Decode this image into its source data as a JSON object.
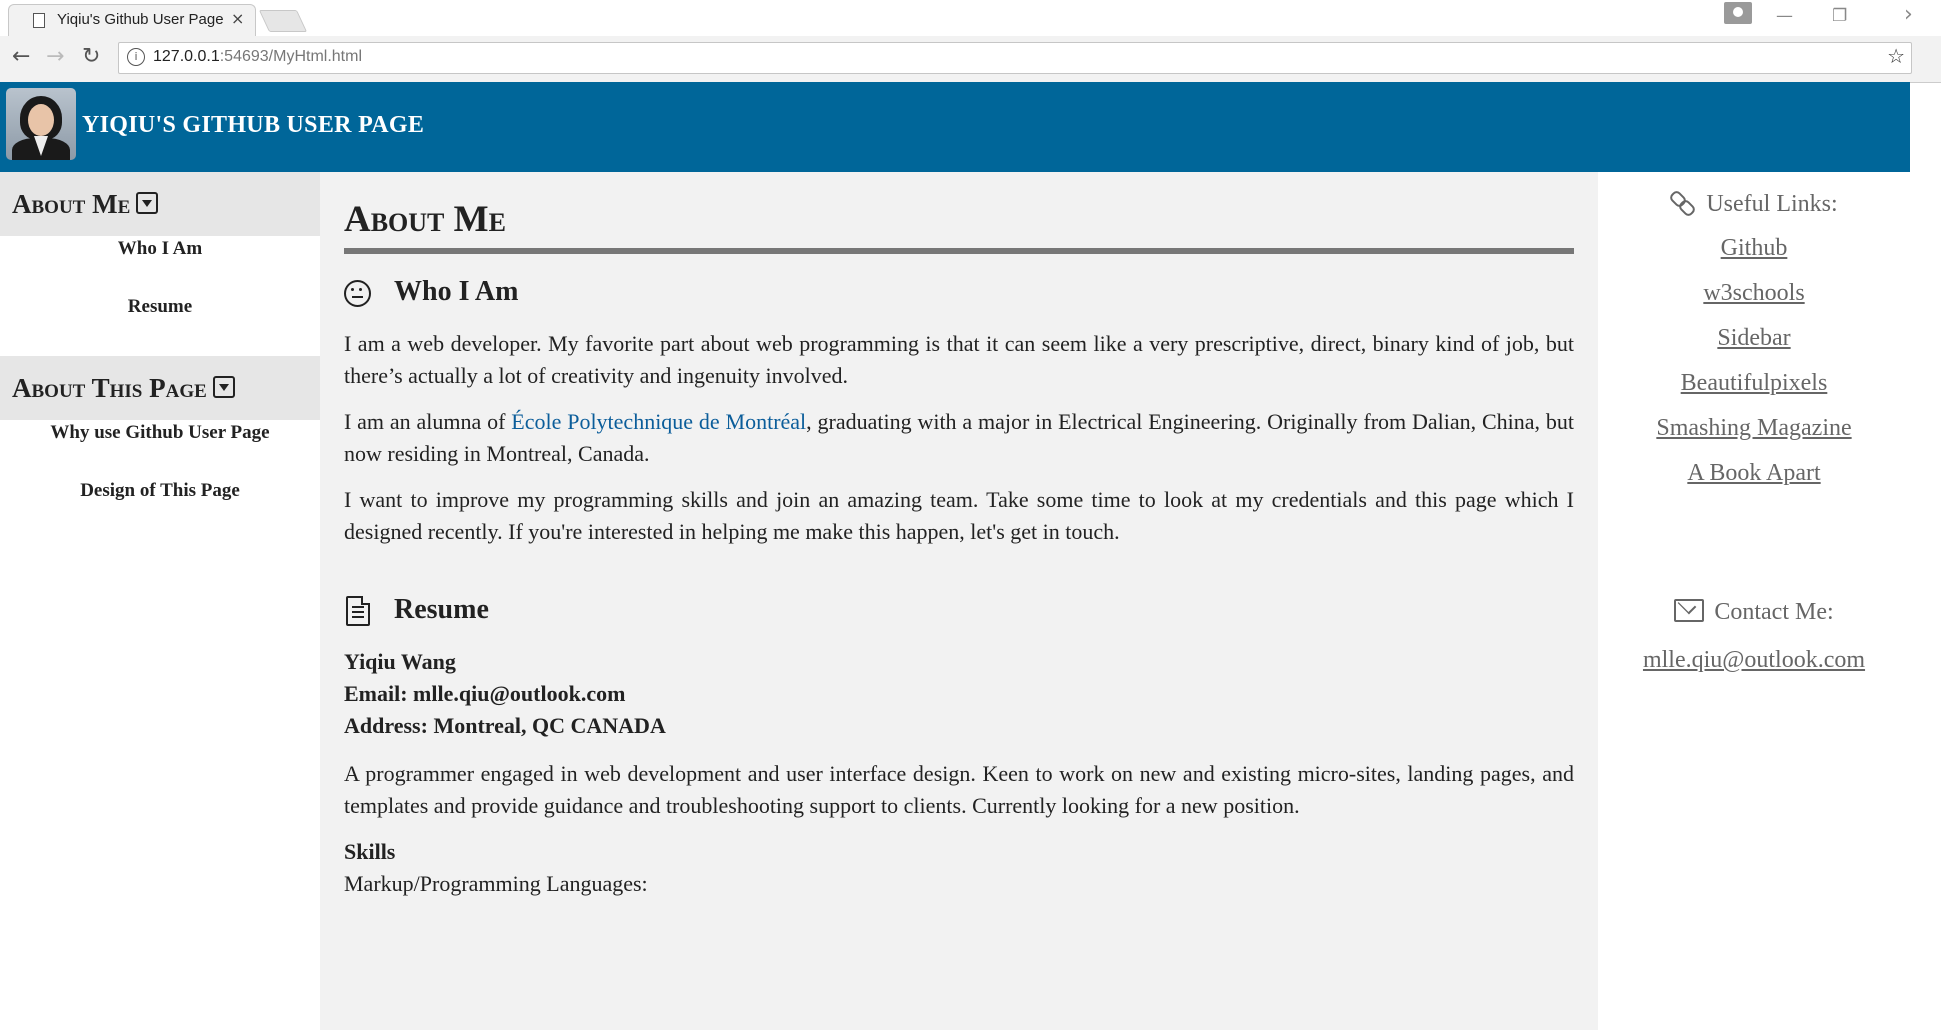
{
  "browser": {
    "tab_title": "Yiqiu's Github User Page",
    "tab_close": "×",
    "url_host": "127.0.0.1",
    "url_path": ":54693/MyHtml.html",
    "back": "←",
    "forward": "→",
    "reload": "↻",
    "minimize": "—",
    "restore": "❐",
    "close": "›"
  },
  "header": {
    "title": "YIQIU'S GITHUB USER PAGE"
  },
  "sidebar": {
    "about_me": {
      "heading": "About Me",
      "links": [
        "Who I Am",
        "Resume"
      ]
    },
    "about_page": {
      "heading": "About This Page",
      "links": [
        "Why use Github User Page",
        "Design of This Page"
      ]
    }
  },
  "main": {
    "title": "About Me",
    "who": {
      "heading": "Who I Am",
      "p1": "I am a web developer. My favorite part about web programming is that it can seem like a very prescriptive, direct, binary kind of job, but there’s actually a lot of creativity and ingenuity involved.",
      "p2_before": "I am an alumna of ",
      "p2_link": "École Polytechnique de Montréal",
      "p2_after": ", graduating with a major in Electrical Engineering. Originally from Dalian, China, but now residing in Montreal, Canada.",
      "p3": "I want to improve my programming skills and join an amazing team. Take some time to look at my credentials and this page which I designed recently. If you're interested in helping me make this happen, let's get in touch."
    },
    "resume": {
      "heading": "Resume",
      "name": "Yiqiu Wang",
      "email": "Email: mlle.qiu@outlook.com",
      "address": "Address: Montreal, QC CANADA",
      "summary": "A programmer engaged in web development and user interface design. Keen to work on new and existing micro-sites, landing pages, and templates and provide guidance and troubleshooting support to clients. Currently looking for a new position.",
      "skills_heading": "Skills",
      "skills_line": "Markup/Programming Languages:"
    }
  },
  "rightbar": {
    "links_heading": "Useful Links:",
    "links": [
      "Github",
      "w3schools",
      "Sidebar",
      "Beautifulpixels",
      "Smashing Magazine",
      "A Book Apart"
    ],
    "contact_heading": "Contact Me:",
    "email": "mlle.qiu@outlook.com"
  },
  "colors": {
    "header_bg": "#006699",
    "main_bg": "#f2f2f2",
    "sidebar_head_bg": "#e6e6e6",
    "link_color": "#0b5d9a"
  }
}
